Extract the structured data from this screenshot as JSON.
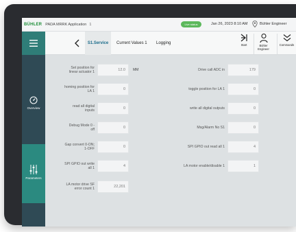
{
  "status_bar": {
    "brand": "BÜHLER",
    "app_title": "PADA MRRK Application",
    "app_badge": "1",
    "live_status": "Live status",
    "datetime": "Jan 26, 2023 8:10 AM",
    "user": "Bühler Engineer"
  },
  "sidebar": {
    "overview_label": "Overview",
    "parameters_label": "Parameters"
  },
  "tabs": {
    "s1_service": "S1.Service",
    "current_values": "Current Values 1",
    "logging": "Logging"
  },
  "actions": {
    "start": "Start",
    "engineer": "Bühler Engineer",
    "commands": "Commands"
  },
  "left_fields": [
    {
      "label": "Set position for linear actuator 1",
      "value": "12.0",
      "unit": "MM"
    },
    {
      "label": "homing position for LA 1",
      "value": "0"
    },
    {
      "label": "read all digital inputs",
      "value": "0"
    },
    {
      "label": "Debug Mode 0 - off",
      "value": "0"
    },
    {
      "label": "Gap convert 0-ON; 1-OFF",
      "value": "0"
    },
    {
      "label": "SPI GPIO out write all 1",
      "value": "4"
    },
    {
      "label": "LA motor drive SF error count 1",
      "value": "22,201"
    }
  ],
  "right_fields": [
    {
      "label": "Drive call ADC in",
      "value": "179"
    },
    {
      "label": "toggle position for LA 1",
      "value": "0"
    },
    {
      "label": "write all digital outputs",
      "value": "0"
    },
    {
      "label": "Msg/Alarm No S1",
      "value": "0"
    },
    {
      "label": "SPI GPIO out read all 1",
      "value": "4"
    },
    {
      "label": "LA motor enable/disable 1",
      "value": "1"
    }
  ]
}
